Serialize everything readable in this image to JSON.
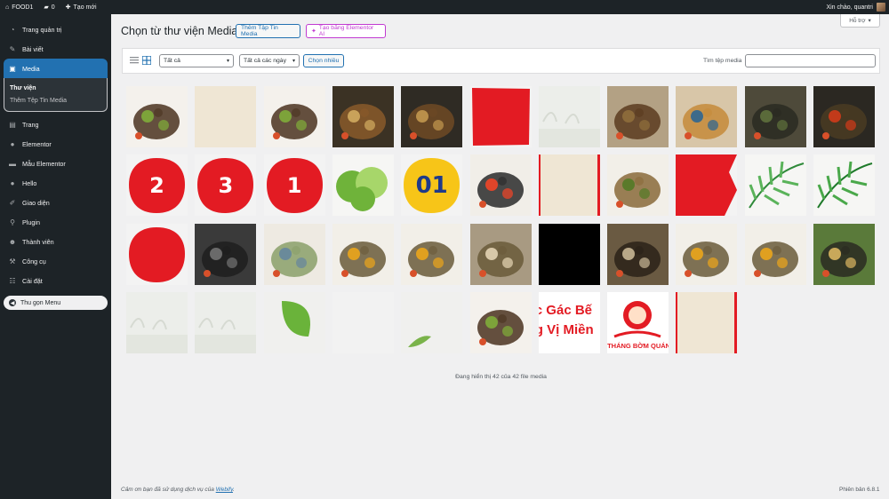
{
  "adminbar": {
    "site_name": "FOOD1",
    "comments_count": "0",
    "new_label": "Tạo mới",
    "greeting": "Xin chào, quantri"
  },
  "sidebar": {
    "items": [
      {
        "label": "Trang quản trị",
        "icon": "dashboard-icon"
      },
      {
        "label": "Bài viết",
        "icon": "pin-icon"
      },
      {
        "label": "Media",
        "icon": "media-icon"
      },
      {
        "label": "Trang",
        "icon": "page-icon"
      },
      {
        "label": "Elementor",
        "icon": "elementor-icon"
      },
      {
        "label": "Mẫu Elementor",
        "icon": "folder-icon"
      },
      {
        "label": "Hello",
        "icon": "hello-icon"
      },
      {
        "label": "Giao diện",
        "icon": "brush-icon"
      },
      {
        "label": "Plugin",
        "icon": "plugin-icon"
      },
      {
        "label": "Thành viên",
        "icon": "user-icon"
      },
      {
        "label": "Công cụ",
        "icon": "wrench-icon"
      },
      {
        "label": "Cài đặt",
        "icon": "settings-icon"
      }
    ],
    "submenu": [
      "Thư viện",
      "Thêm Tệp Tin Media"
    ],
    "collapse_label": "Thu gọn Menu"
  },
  "header": {
    "title": "Chọn từ thư viện Media",
    "add_button": "Thêm Tập Tin Media",
    "ai_button": "Tạo bằng Elementor AI",
    "help": "Hỗ trợ"
  },
  "toolbar": {
    "filter_type": "Tất cả",
    "filter_date": "Tất cả các ngày",
    "bulk_select": "Chọn nhiều",
    "search_label": "Tìm tệp media",
    "search_value": ""
  },
  "media": {
    "items": [
      {
        "kind": "food",
        "colors": [
          "#f4f1ec",
          "#4a3320",
          "#7da33a"
        ],
        "text": ""
      },
      {
        "kind": "paper",
        "colors": [
          "#efe6d4"
        ],
        "text": ""
      },
      {
        "kind": "food",
        "colors": [
          "#f4f1ec",
          "#4a3320",
          "#7da33a"
        ],
        "text": ""
      },
      {
        "kind": "food",
        "colors": [
          "#3b3224",
          "#8a5a2a",
          "#c9a25a"
        ],
        "text": ""
      },
      {
        "kind": "food",
        "colors": [
          "#2f2b24",
          "#6e4a25",
          "#b98f4a"
        ],
        "text": ""
      },
      {
        "kind": "red",
        "colors": [
          "#e31b23"
        ],
        "text": ""
      },
      {
        "kind": "faint",
        "colors": [
          "#eceeea"
        ],
        "text": ""
      },
      {
        "kind": "food",
        "colors": [
          "#b3a184",
          "#5a3b1e",
          "#8b6a3a"
        ],
        "text": ""
      },
      {
        "kind": "food",
        "colors": [
          "#d8c6a8",
          "#c58a3a",
          "#3d6a8a"
        ],
        "text": ""
      },
      {
        "kind": "food",
        "colors": [
          "#4e4a3a",
          "#2a2a22",
          "#5a6a3a"
        ],
        "text": ""
      },
      {
        "kind": "food",
        "colors": [
          "#2b2822",
          "#4a3b22",
          "#c23a1a"
        ],
        "text": ""
      },
      {
        "kind": "circle",
        "colors": [
          "#e31b23"
        ],
        "text": "2"
      },
      {
        "kind": "circle",
        "colors": [
          "#e31b23"
        ],
        "text": "3"
      },
      {
        "kind": "circle",
        "colors": [
          "#e31b23"
        ],
        "text": "1"
      },
      {
        "kind": "lettuce",
        "colors": [
          "#6fb33a",
          "#a7d66a"
        ],
        "text": ""
      },
      {
        "kind": "circle-yellow",
        "colors": [
          "#f7c518",
          "#1e3a8a"
        ],
        "text": "01"
      },
      {
        "kind": "food",
        "colors": [
          "#f1eee8",
          "#2a2a2a",
          "#e0452a"
        ],
        "text": ""
      },
      {
        "kind": "paper-red",
        "colors": [
          "#efe6d4",
          "#e31b23"
        ],
        "text": ""
      },
      {
        "kind": "food",
        "colors": [
          "#f2efe8",
          "#8a6a3a",
          "#5a7a2a"
        ],
        "text": ""
      },
      {
        "kind": "brush",
        "colors": [
          "#e31b23"
        ],
        "text": ""
      },
      {
        "kind": "palm",
        "colors": [
          "#2f8a3a",
          "#5ab35a"
        ],
        "text": ""
      },
      {
        "kind": "palm",
        "colors": [
          "#1f7a2a",
          "#4aa84a"
        ],
        "text": ""
      },
      {
        "kind": "circle",
        "colors": [
          "#e31b23"
        ],
        "text": ""
      },
      {
        "kind": "food",
        "colors": [
          "#3a3a3a",
          "#1e1e1e",
          "#6a6a6a"
        ],
        "text": ""
      },
      {
        "kind": "food",
        "colors": [
          "#eeeae2",
          "#8aa06a",
          "#6a8a9a"
        ],
        "text": ""
      },
      {
        "kind": "food",
        "colors": [
          "#f2efe8",
          "#6a5a3a",
          "#e0a020"
        ],
        "text": ""
      },
      {
        "kind": "food",
        "colors": [
          "#f2efe8",
          "#6a5a3a",
          "#e0a020"
        ],
        "text": ""
      },
      {
        "kind": "food",
        "colors": [
          "#a89a82",
          "#6a5a3a",
          "#d8c8a8"
        ],
        "text": ""
      },
      {
        "kind": "black",
        "colors": [
          "#000000"
        ],
        "text": ""
      },
      {
        "kind": "food",
        "colors": [
          "#6a5a42",
          "#2a2218",
          "#b8a888"
        ],
        "text": ""
      },
      {
        "kind": "food",
        "colors": [
          "#f2efe8",
          "#6a5a3a",
          "#e0a020"
        ],
        "text": ""
      },
      {
        "kind": "food",
        "colors": [
          "#f2efe8",
          "#6a5a3a",
          "#e0a020"
        ],
        "text": ""
      },
      {
        "kind": "food",
        "colors": [
          "#5a7a3a",
          "#2a2a22",
          "#c8a85a"
        ],
        "text": ""
      },
      {
        "kind": "faint",
        "colors": [
          "#eceeea"
        ],
        "text": ""
      },
      {
        "kind": "faint",
        "colors": [
          "#eceeea"
        ],
        "text": ""
      },
      {
        "kind": "leaf",
        "colors": [
          "#f0f0ee",
          "#6ab33a"
        ],
        "text": ""
      },
      {
        "kind": "blank",
        "colors": [
          "#f2f2f2"
        ],
        "text": ""
      },
      {
        "kind": "leaf-small",
        "colors": [
          "#f0f0ee",
          "#7ab34a"
        ],
        "text": ""
      },
      {
        "kind": "food",
        "colors": [
          "#f4f1ec",
          "#4a3320",
          "#7da33a"
        ],
        "text": ""
      },
      {
        "kind": "text-red",
        "colors": [
          "#ffffff",
          "#e31b23"
        ],
        "text": "c Gác Bế|g Vị Miền"
      },
      {
        "kind": "logo",
        "colors": [
          "#ffffff",
          "#e31b23"
        ],
        "text": "THÁNG BỜM QUÁN"
      },
      {
        "kind": "paper-red",
        "colors": [
          "#efe6d4",
          "#e31b23"
        ],
        "text": ""
      }
    ],
    "count_text": "Đang hiển thị 42 của 42 file media"
  },
  "footer": {
    "thanks_prefix": "Cảm ơn bạn đã sử dụng dịch vụ của",
    "link": "Webify",
    "thanks_suffix": ".",
    "version": "Phiên bản 6.8.1"
  }
}
